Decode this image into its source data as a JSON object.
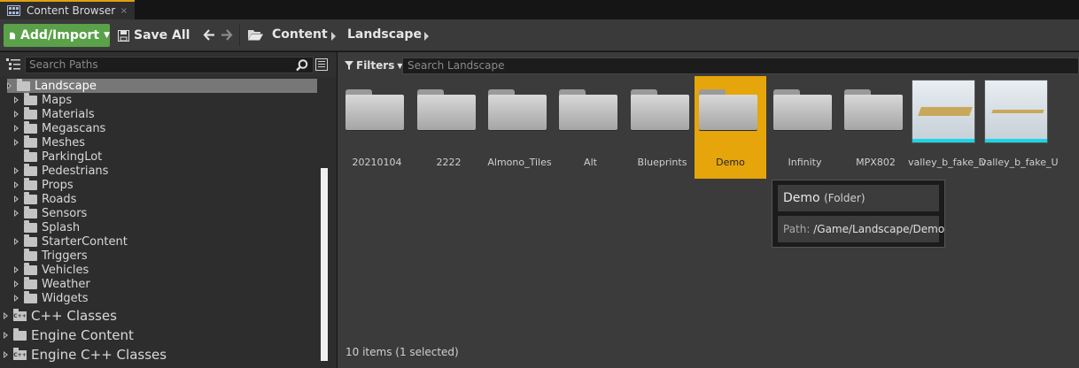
{
  "tab": {
    "title": "Content Browser",
    "close": "×"
  },
  "toolbar": {
    "add_import": "Add/Import",
    "save_all": "Save All",
    "breadcrumbs": [
      "Content",
      "Landscape"
    ]
  },
  "paths": {
    "search_placeholder": "Search Paths",
    "tree": [
      {
        "label": "Landscape",
        "expandable": true,
        "selected": true
      },
      {
        "label": "Maps",
        "expandable": true
      },
      {
        "label": "Materials",
        "expandable": true
      },
      {
        "label": "Megascans",
        "expandable": true
      },
      {
        "label": "Meshes",
        "expandable": true
      },
      {
        "label": "ParkingLot",
        "expandable": false
      },
      {
        "label": "Pedestrians",
        "expandable": true
      },
      {
        "label": "Props",
        "expandable": true
      },
      {
        "label": "Roads",
        "expandable": true
      },
      {
        "label": "Sensors",
        "expandable": true
      },
      {
        "label": "Splash",
        "expandable": false
      },
      {
        "label": "StarterContent",
        "expandable": true
      },
      {
        "label": "Triggers",
        "expandable": false
      },
      {
        "label": "Vehicles",
        "expandable": true
      },
      {
        "label": "Weather",
        "expandable": true
      },
      {
        "label": "Widgets",
        "expandable": true
      }
    ],
    "roots": [
      {
        "label": "C++ Classes",
        "icon": "cpp-folder-icon"
      },
      {
        "label": "Engine Content",
        "icon": "folder-icon"
      },
      {
        "label": "Engine C++ Classes",
        "icon": "cpp-folder-icon"
      }
    ]
  },
  "content": {
    "filters_label": "Filters",
    "search_placeholder": "Search Landscape",
    "assets": [
      {
        "label": "20210104",
        "kind": "folder"
      },
      {
        "label": "2222",
        "kind": "folder"
      },
      {
        "label": "Almono_Tiles",
        "kind": "folder"
      },
      {
        "label": "Alt",
        "kind": "folder"
      },
      {
        "label": "Blueprints",
        "kind": "folder"
      },
      {
        "label": "Demo",
        "kind": "folder",
        "selected": true
      },
      {
        "label": "Infinity",
        "kind": "folder"
      },
      {
        "label": "MPX802",
        "kind": "folder"
      },
      {
        "label": "valley_b_fake_D",
        "kind": "landscape"
      },
      {
        "label": "valley_b_fake_U",
        "kind": "landscape"
      }
    ],
    "tooltip": {
      "name": "Demo",
      "type": "(Folder)",
      "path_key": "Path:",
      "path_value": "/Game/Landscape/Demo"
    },
    "status": "10 items (1 selected)"
  },
  "colors": {
    "accent": "#e5a50b",
    "add_button": "#5aa14a",
    "selection": "#777777",
    "thumbnail_band": "#19d7e6"
  }
}
